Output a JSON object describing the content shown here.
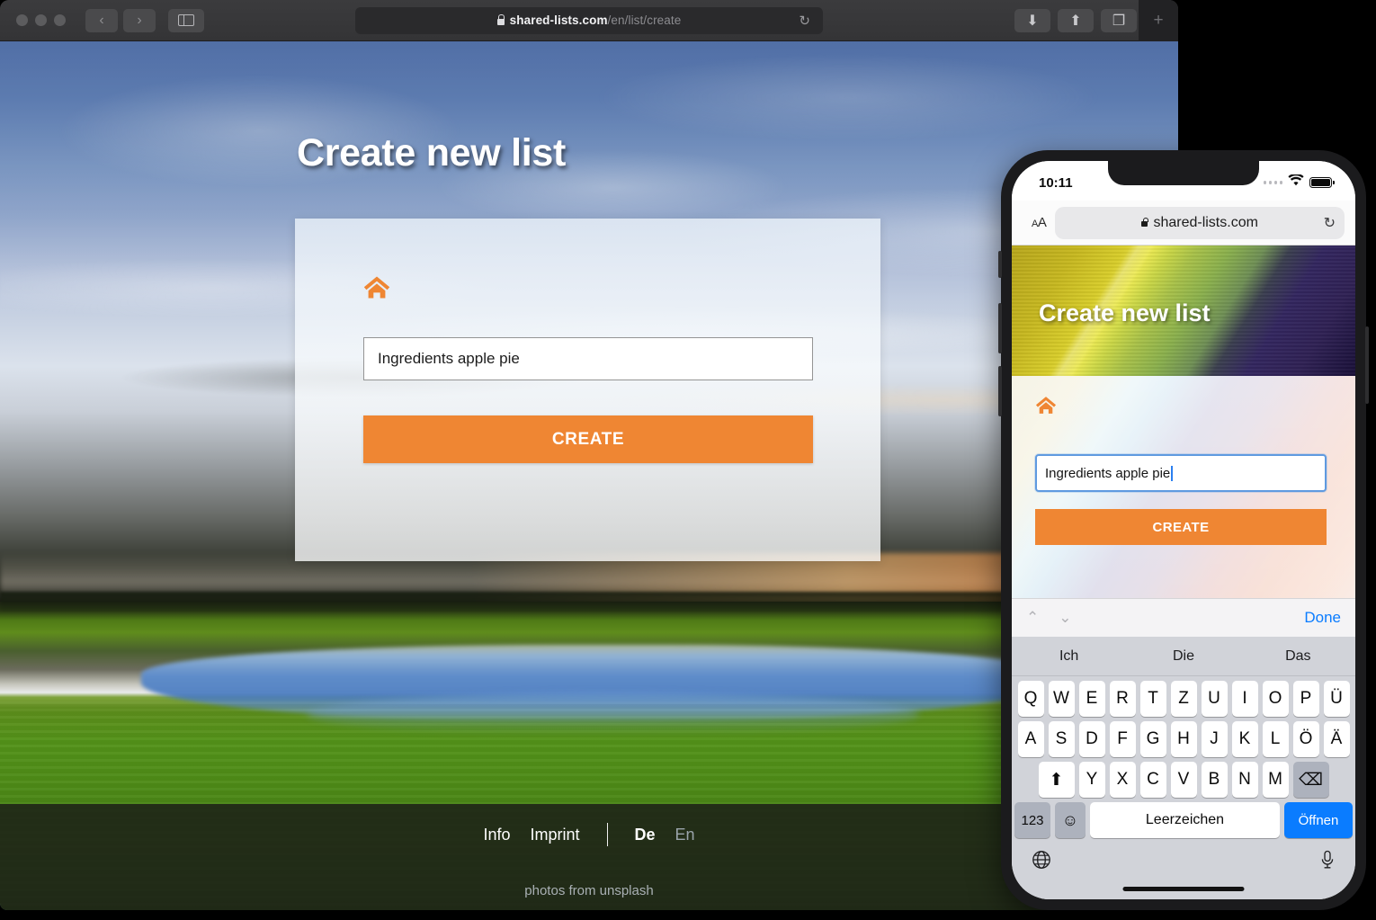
{
  "browser": {
    "url_domain": "shared-lists.com",
    "url_path": "/en/list/create",
    "back_icon": "‹",
    "forward_icon": "›",
    "reload_icon": "↻",
    "download_icon": "⬇",
    "share_icon": "⬆",
    "tabs_icon": "❐",
    "newtab_icon": "+"
  },
  "page": {
    "title": "Create new list",
    "home_icon": "home-icon",
    "input_value": "Ingredients apple pie",
    "create_label": "CREATE",
    "footer": {
      "info": "Info",
      "imprint": "Imprint",
      "lang_de": "De",
      "lang_en": "En",
      "credit": "photos from unsplash"
    }
  },
  "phone": {
    "status": {
      "time": "10:11",
      "wifi_icon": "wifi-icon",
      "battery_icon": "battery-icon"
    },
    "safari": {
      "aa_label": "AA",
      "url": "shared-lists.com",
      "reload_icon": "↻"
    },
    "page": {
      "title": "Create new list",
      "input_value": "Ingredients apple pie",
      "create_label": "CREATE"
    },
    "accessory": {
      "prev_icon": "⌃",
      "next_icon": "⌄",
      "done_label": "Done"
    },
    "keyboard": {
      "predictions": [
        "Ich",
        "Die",
        "Das"
      ],
      "row1": [
        "Q",
        "W",
        "E",
        "R",
        "T",
        "Z",
        "U",
        "I",
        "O",
        "P",
        "Ü"
      ],
      "row2": [
        "A",
        "S",
        "D",
        "F",
        "G",
        "H",
        "J",
        "K",
        "L",
        "Ö",
        "Ä"
      ],
      "row3": [
        "Y",
        "X",
        "C",
        "V",
        "B",
        "N",
        "M"
      ],
      "shift_icon": "⬆",
      "backspace_icon": "⌫",
      "numbers_label": "123",
      "emoji_icon": "☺",
      "space_label": "Leerzeichen",
      "go_label": "Öffnen",
      "globe_icon": "globe-icon",
      "mic_icon": "mic-icon"
    }
  },
  "colors": {
    "accent_orange": "#ef8633",
    "ios_blue": "#0a7cff"
  }
}
